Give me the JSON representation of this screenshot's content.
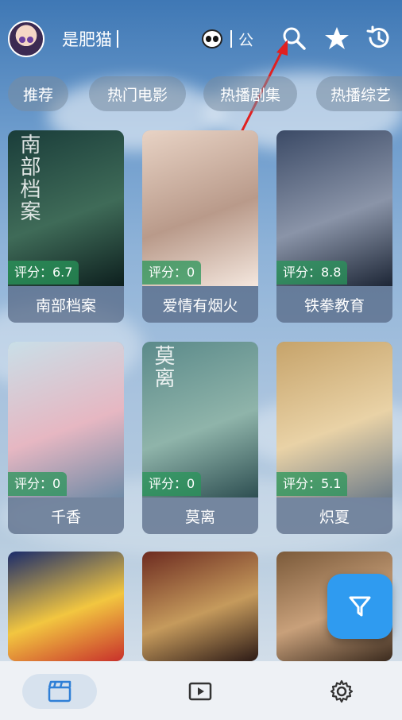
{
  "header": {
    "username": "是肥猫",
    "extra_text": "公"
  },
  "tabs": [
    {
      "label": "推荐"
    },
    {
      "label": "热门电影"
    },
    {
      "label": "热播剧集"
    },
    {
      "label": "热播综艺"
    }
  ],
  "cards": [
    {
      "name": "南部档案",
      "rating": "评分：6.7",
      "poster_title": "南部档案",
      "colors": [
        "#1a3d3a",
        "#3f6b58",
        "#0d1f1e"
      ]
    },
    {
      "name": "爱情有烟火",
      "rating": "评分：0",
      "poster_title": "",
      "colors": [
        "#e8d3c5",
        "#b99a8a",
        "#f4e7de"
      ]
    },
    {
      "name": "铁拳教育",
      "rating": "评分：8.8",
      "poster_title": "",
      "colors": [
        "#3b4a66",
        "#8a94a8",
        "#1d2636"
      ]
    },
    {
      "name": "千香",
      "rating": "评分：0",
      "poster_title": "",
      "colors": [
        "#c9dfe8",
        "#e6b7c2",
        "#6f8aa6"
      ]
    },
    {
      "name": "莫离",
      "rating": "评分：0",
      "poster_title": "莫离",
      "colors": [
        "#5b8a8a",
        "#8fb4aa",
        "#2e4f52"
      ]
    },
    {
      "name": "炽夏",
      "rating": "评分：5.1",
      "poster_title": "",
      "colors": [
        "#c6a36a",
        "#e9d2a6",
        "#6f7d8a"
      ]
    },
    {
      "name": "",
      "rating": "",
      "poster_title": "",
      "colors": [
        "#1a2b6b",
        "#f2c640",
        "#c8302b"
      ]
    },
    {
      "name": "",
      "rating": "",
      "poster_title": "",
      "colors": [
        "#6d2b20",
        "#c59a5c",
        "#2c1a16"
      ]
    },
    {
      "name": "",
      "rating": "",
      "poster_title": "",
      "colors": [
        "#7b5a3a",
        "#c8a07a",
        "#3a2a1e"
      ]
    }
  ],
  "colors": {
    "accent": "#2f9bf0",
    "annotation_arrow": "#e02020"
  },
  "icons": {
    "header": [
      "avatar",
      "panda-icon",
      "search-icon",
      "star-icon",
      "history-icon"
    ],
    "fab": "filter-icon",
    "nav": [
      "clapperboard-icon",
      "play-icon",
      "gear-icon"
    ]
  }
}
